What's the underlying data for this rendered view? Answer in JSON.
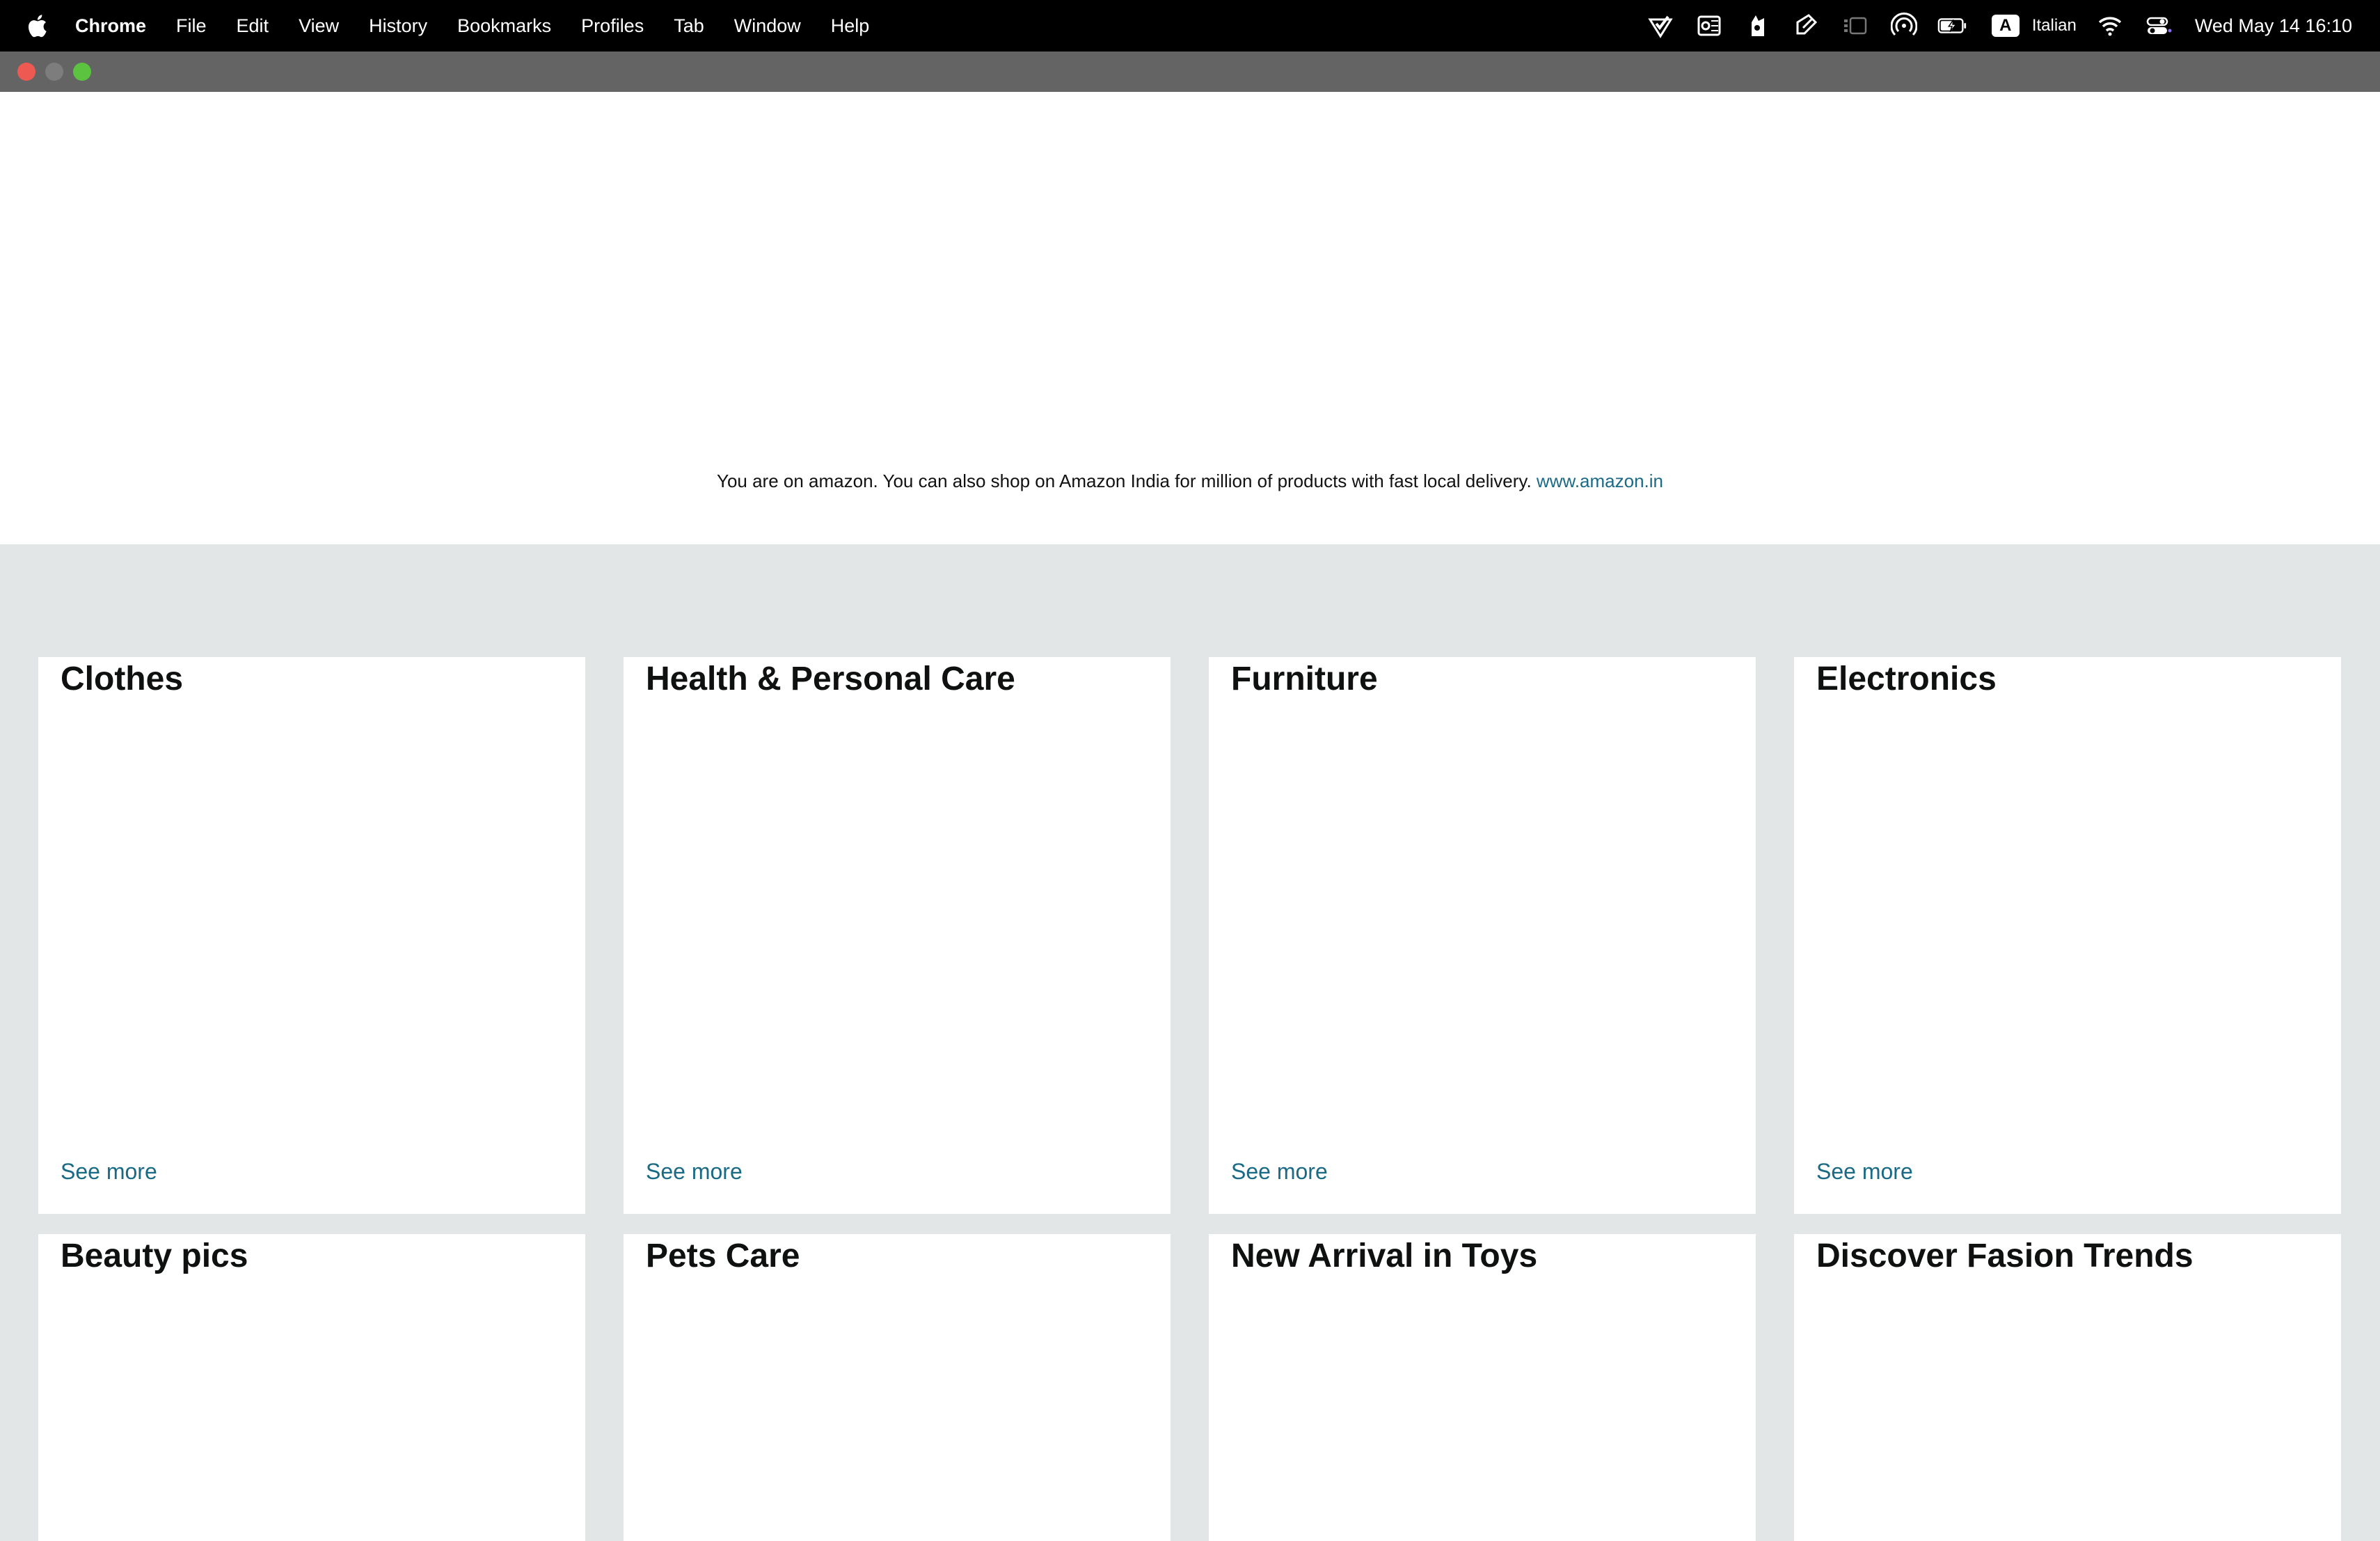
{
  "menubar": {
    "app_name": "Chrome",
    "items": [
      "File",
      "Edit",
      "View",
      "History",
      "Bookmarks",
      "Profiles",
      "Tab",
      "Window",
      "Help"
    ],
    "input_source_badge": "A",
    "input_source_lang": "Italian",
    "clock": "Wed May 14  16:10",
    "status_icons": [
      "vpn-check-icon",
      "outlook-icon",
      "scrobbler-icon",
      "pen-tablet-icon",
      "stage-manager-icon",
      "airdrop-icon",
      "battery-charging-icon",
      "wifi-icon",
      "control-center-icon"
    ]
  },
  "window": {
    "controls": [
      "close",
      "minimize",
      "maximize"
    ],
    "colors": {
      "close": "#ee5a52",
      "minimize": "#7d7d7d",
      "maximize": "#5bc340"
    }
  },
  "notice": {
    "text": "You are on amazon. You can also shop on Amazon India for million of products with fast local delivery.",
    "link": "www.amazon.in"
  },
  "cards": [
    {
      "title": "Clothes",
      "link": "See more"
    },
    {
      "title": "Health & Personal Care",
      "link": "See more"
    },
    {
      "title": "Furniture",
      "link": "See more"
    },
    {
      "title": "Electronics",
      "link": "See more"
    },
    {
      "title": "Beauty pics"
    },
    {
      "title": "Pets Care"
    },
    {
      "title": "New Arrival in Toys"
    },
    {
      "title": "Discover Fasion Trends"
    }
  ],
  "colors": {
    "link": "#1a6a86",
    "grid_background": "#e3e6e6"
  }
}
